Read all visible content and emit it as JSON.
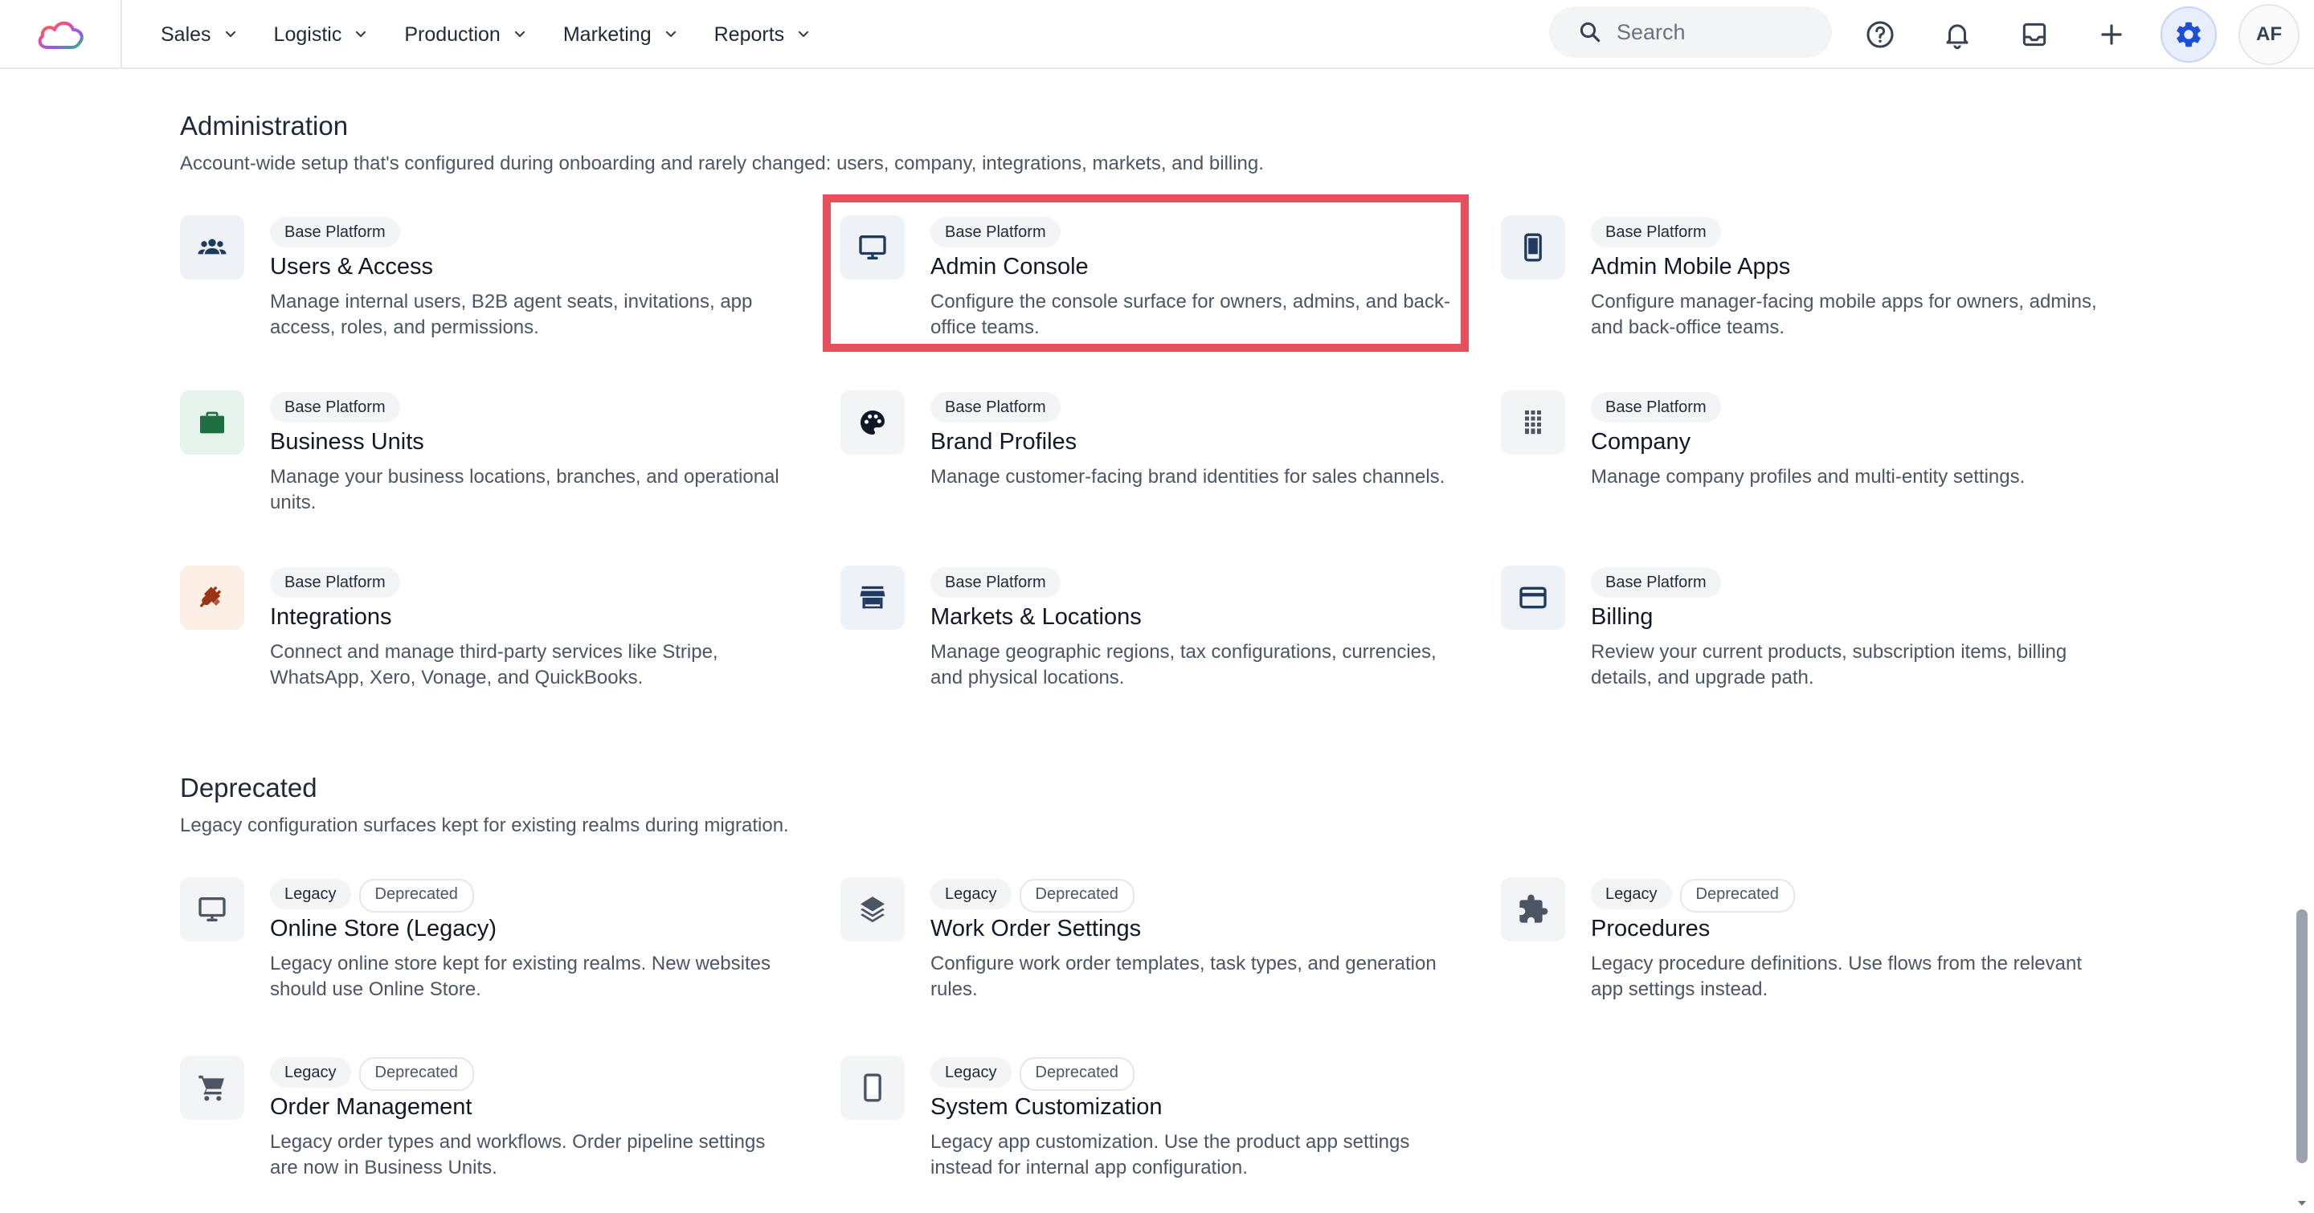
{
  "nav": {
    "items": [
      {
        "label": "Sales"
      },
      {
        "label": "Logistic"
      },
      {
        "label": "Production"
      },
      {
        "label": "Marketing"
      },
      {
        "label": "Reports"
      }
    ]
  },
  "search": {
    "placeholder": "Search"
  },
  "user": {
    "initials": "AF"
  },
  "administration": {
    "title": "Administration",
    "description": "Account-wide setup that's configured during onboarding and rarely changed: users, company, integrations, markets, and billing.",
    "cards": [
      {
        "badge": "Base Platform",
        "title": "Users & Access",
        "description": "Manage internal users, B2B agent seats, invitations, app access, roles, and permissions.",
        "icon": "users-icon"
      },
      {
        "badge": "Base Platform",
        "title": "Admin Console",
        "description": "Configure the console surface for owners, admins, and back-office teams.",
        "icon": "monitor-icon"
      },
      {
        "badge": "Base Platform",
        "title": "Admin Mobile Apps",
        "description": "Configure manager-facing mobile apps for owners, admins, and back-office teams.",
        "icon": "mobile-icon"
      },
      {
        "badge": "Base Platform",
        "title": "Business Units",
        "description": "Manage your business locations, branches, and operational units.",
        "icon": "briefcase-icon"
      },
      {
        "badge": "Base Platform",
        "title": "Brand Profiles",
        "description": "Manage customer-facing brand identities for sales channels.",
        "icon": "palette-icon"
      },
      {
        "badge": "Base Platform",
        "title": "Company",
        "description": "Manage company profiles and multi-entity settings.",
        "icon": "building-icon"
      },
      {
        "badge": "Base Platform",
        "title": "Integrations",
        "description": "Connect and manage third-party services like Stripe, WhatsApp, Xero, Vonage, and QuickBooks.",
        "icon": "plug-icon"
      },
      {
        "badge": "Base Platform",
        "title": "Markets & Locations",
        "description": "Manage geographic regions, tax configurations, currencies, and physical locations.",
        "icon": "store-icon"
      },
      {
        "badge": "Base Platform",
        "title": "Billing",
        "description": "Review your current products, subscription items, billing details, and upgrade path.",
        "icon": "credit-card-icon"
      }
    ]
  },
  "deprecated": {
    "title": "Deprecated",
    "description": "Legacy configuration surfaces kept for existing realms during migration.",
    "cards": [
      {
        "badge1": "Legacy",
        "badge2": "Deprecated",
        "title": "Online Store (Legacy)",
        "description": "Legacy online store kept for existing realms. New websites should use Online Store.",
        "icon": "monitor-icon"
      },
      {
        "badge1": "Legacy",
        "badge2": "Deprecated",
        "title": "Work Order Settings",
        "description": "Configure work order templates, task types, and generation rules.",
        "icon": "layers-icon"
      },
      {
        "badge1": "Legacy",
        "badge2": "Deprecated",
        "title": "Procedures",
        "description": "Legacy procedure definitions. Use flows from the relevant app settings instead.",
        "icon": "puzzle-icon"
      },
      {
        "badge1": "Legacy",
        "badge2": "Deprecated",
        "title": "Order Management",
        "description": "Legacy order types and workflows. Order pipeline settings are now in Business Units.",
        "icon": "cart-icon"
      },
      {
        "badge1": "Legacy",
        "badge2": "Deprecated",
        "title": "System Customization",
        "description": "Legacy app customization. Use the product app settings instead for internal app configuration.",
        "icon": "mobile-icon"
      }
    ]
  },
  "colors": {
    "accent": "#1d4ed8",
    "highlight": "#e5505c",
    "icon": "#1e3a5f"
  }
}
